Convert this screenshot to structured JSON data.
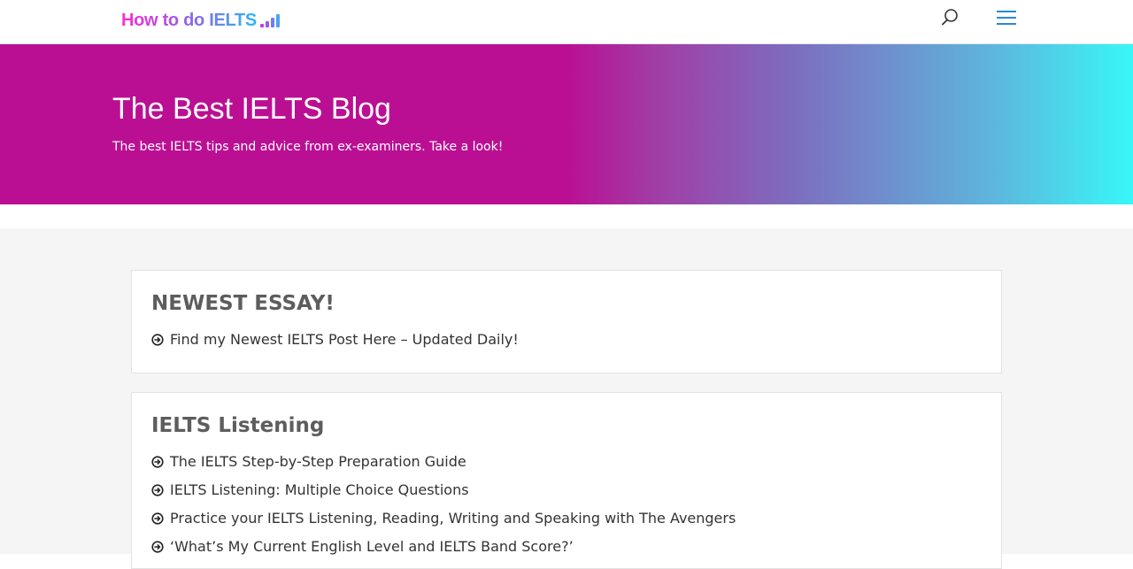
{
  "header": {
    "logo_text": "How to do IELTS",
    "logo_colors": [
      "#ff2bd6",
      "#9a5be8",
      "#2bb7f0"
    ],
    "search_icon": "search-icon",
    "menu_icon": "hamburger-menu-icon"
  },
  "hero": {
    "title": "The Best IELTS Blog",
    "subtitle": "The best IELTS tips and advice from ex-examiners. Take a look!",
    "gradient_colors": [
      "#bb0f93",
      "#38f7f8"
    ]
  },
  "sections": [
    {
      "title": "NEWEST ESSAY!",
      "links": [
        "Find my Newest IELTS Post Here – Updated Daily!"
      ]
    },
    {
      "title": "IELTS Listening",
      "links": [
        "The IELTS Step-by-Step Preparation Guide",
        "IELTS Listening: Multiple Choice Questions",
        "Practice your IELTS Listening, Reading, Writing and Speaking with The Avengers",
        "‘What’s My Current English Level and IELTS Band Score?’"
      ]
    }
  ],
  "link_icon": "arrow-right-circle-icon",
  "accent_color": "#2b87da"
}
